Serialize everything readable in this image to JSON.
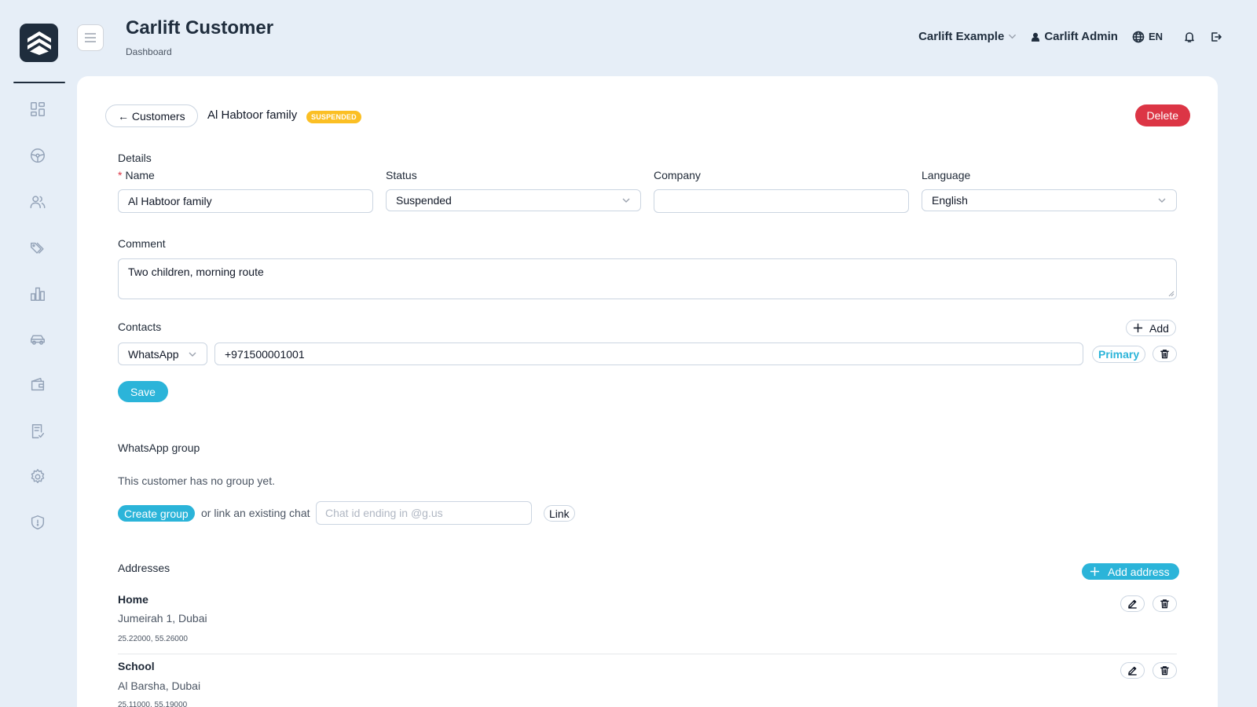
{
  "header": {
    "title": "Carlift Customer",
    "subtitle": "Dashboard",
    "org_name": "Carlift Example",
    "user_name": "Carlift Admin",
    "language": "EN"
  },
  "sidebar": {
    "items": [
      {
        "icon": "dashboard-icon"
      },
      {
        "icon": "steering-wheel-icon"
      },
      {
        "icon": "users-icon"
      },
      {
        "icon": "tags-icon"
      },
      {
        "icon": "bar-chart-icon"
      },
      {
        "icon": "car-icon"
      },
      {
        "icon": "wallet-icon"
      },
      {
        "icon": "checklist-icon"
      },
      {
        "icon": "gear-icon"
      },
      {
        "icon": "shield-icon"
      }
    ]
  },
  "customer": {
    "back_label": "← Customers",
    "name": "Al Habtoor family",
    "status_badge": "SUSPENDED",
    "delete_label": "Delete"
  },
  "details": {
    "section_label": "Details",
    "name_label": "Name",
    "name_value": "Al Habtoor family",
    "status_label": "Status",
    "status_value": "Suspended",
    "company_label": "Company",
    "company_value": "",
    "language_label": "Language",
    "language_value": "English",
    "comment_label": "Comment",
    "comment_value": "Two children, morning route"
  },
  "contacts": {
    "section_label": "Contacts",
    "add_label": "Add",
    "items": [
      {
        "type": "WhatsApp",
        "value": "+971500001001",
        "primary_label": "Primary"
      }
    ]
  },
  "save_label": "Save",
  "whatsapp_group": {
    "section_label": "WhatsApp group",
    "empty_text": "This customer has no group yet.",
    "create_label": "Create group",
    "or_text": "or link an existing chat",
    "chat_placeholder": "Chat id ending in @g.us",
    "link_label": "Link"
  },
  "addresses": {
    "section_label": "Addresses",
    "add_label": "Add address",
    "items": [
      {
        "title": "Home",
        "line": "Jumeirah 1, Dubai",
        "coords": "25.22000, 55.26000"
      },
      {
        "title": "School",
        "line": "Al Barsha, Dubai",
        "coords": "25.11000, 55.19000"
      }
    ]
  },
  "colors": {
    "accent": "#2bb4d9",
    "danger": "#dc3545",
    "warning": "#fbbf24",
    "navy": "#1f2d3d",
    "background": "#e6eef7"
  }
}
